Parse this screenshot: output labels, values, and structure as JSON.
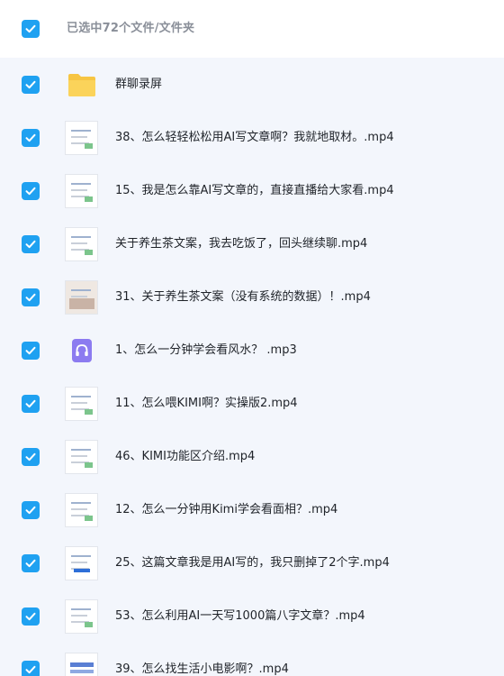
{
  "header": {
    "selection_label": "已选中72个文件/文件夹"
  },
  "colors": {
    "checkbox": "#1fa1f1",
    "folder": "#f7c542",
    "audio": "#8c7bf0",
    "background": "#f3f6fc"
  },
  "files": [
    {
      "name": "群聊录屏",
      "type": "folder",
      "icon": "folder-icon",
      "checked": true
    },
    {
      "name": "38、怎么轻轻松松用AI写文章啊？我就地取材。.mp4",
      "type": "video",
      "icon": "video-thumbnail",
      "checked": true
    },
    {
      "name": "15、我是怎么靠AI写文章的，直接直播给大家看.mp4",
      "type": "video",
      "icon": "video-thumbnail",
      "checked": true
    },
    {
      "name": "关于养生茶文案，我去吃饭了，回头继续聊.mp4",
      "type": "video",
      "icon": "video-thumbnail",
      "checked": true
    },
    {
      "name": "31、关于养生茶文案（没有系统的数据）！.mp4",
      "type": "video",
      "icon": "video-thumbnail",
      "checked": true
    },
    {
      "name": "1、怎么一分钟学会看风水？ .mp3",
      "type": "audio",
      "icon": "audio-file-icon",
      "checked": true
    },
    {
      "name": "11、怎么喂KIMI啊？实操版2.mp4",
      "type": "video",
      "icon": "video-thumbnail",
      "checked": true
    },
    {
      "name": "46、KIMI功能区介绍.mp4",
      "type": "video",
      "icon": "video-thumbnail",
      "checked": true
    },
    {
      "name": "12、怎么一分钟用Kimi学会看面相？.mp4",
      "type": "video",
      "icon": "video-thumbnail",
      "checked": true
    },
    {
      "name": "25、这篇文章我是用AI写的，我只删掉了2个字.mp4",
      "type": "video",
      "icon": "video-thumbnail",
      "checked": true
    },
    {
      "name": "53、怎么利用AI一天写1000篇八字文章？.mp4",
      "type": "video",
      "icon": "video-thumbnail",
      "checked": true
    },
    {
      "name": "39、怎么找生活小电影啊？.mp4",
      "type": "video",
      "icon": "video-thumbnail",
      "checked": true
    }
  ]
}
